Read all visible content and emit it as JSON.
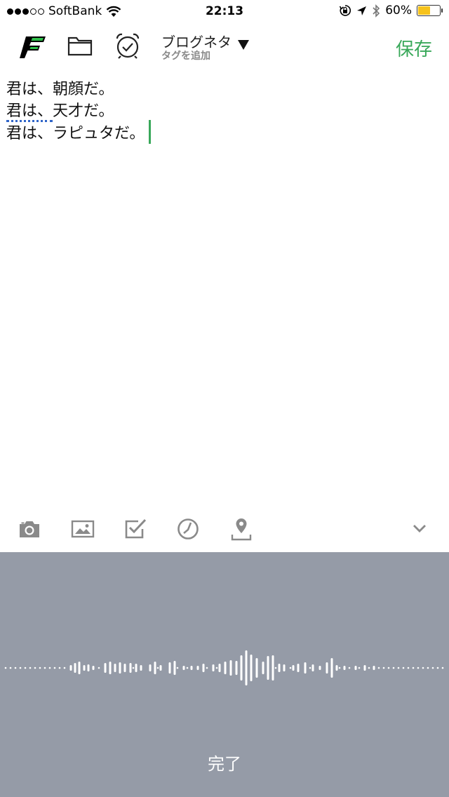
{
  "status_bar": {
    "carrier": "SoftBank",
    "signal_filled": 3,
    "signal_total": 5,
    "time": "22:13",
    "battery_percent": "60%",
    "battery_level": 0.6,
    "battery_color": "#f6c21b"
  },
  "toolbar": {
    "notebook_name": "ブログネタ",
    "tag_placeholder": "タグを追加",
    "save_label": "保存",
    "accent_color": "#39a85a",
    "icons": [
      "app-logo-icon",
      "folder-icon",
      "alarm-clock-icon",
      "dropdown-triangle-icon"
    ]
  },
  "note": {
    "lines": [
      {
        "text": "君は、朝顔だ。"
      },
      {
        "misspelled": "君は、",
        "text": "天才だ。"
      },
      {
        "text": "君は、ラピュタだ。"
      }
    ]
  },
  "edit_bar": {
    "icons": [
      "camera-icon",
      "image-icon",
      "checkbox-icon",
      "clock-icon",
      "location-pin-icon",
      "chevron-down-icon"
    ]
  },
  "dictation": {
    "done_label": "完了",
    "panel_color": "#959ba7"
  }
}
